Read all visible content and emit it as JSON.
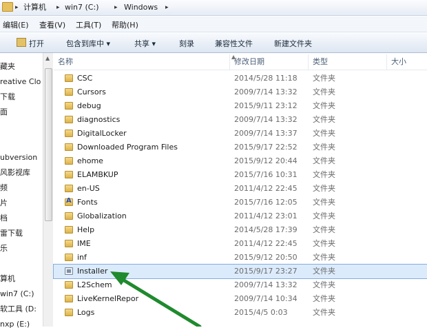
{
  "address": {
    "crumbs": [
      "计算机",
      "win7 (C:)",
      "Windows"
    ]
  },
  "menu": [
    "编辑(E)",
    "查看(V)",
    "工具(T)",
    "帮助(H)"
  ],
  "toolbar": {
    "open": "打开",
    "include": "包含到库中 ▾",
    "share": "共享 ▾",
    "burn": "刻录",
    "compat": "兼容性文件",
    "new_folder": "新建文件夹"
  },
  "nav": [
    "藏夹",
    "reative Clo",
    "下载",
    "面",
    "",
    "ubversion",
    "风影视库",
    "频",
    "片",
    "档",
    "雷下载",
    "乐",
    "",
    "算机",
    "win7 (C:)",
    "软工具 (D:",
    "nxp (E:)"
  ],
  "columns": {
    "name": "名称",
    "date": "修改日期",
    "type": "类型",
    "size": "大小"
  },
  "files": [
    {
      "name": "CSC",
      "date": "2014/5/28 11:18",
      "type": "文件夹",
      "icon": "folder-icon"
    },
    {
      "name": "Cursors",
      "date": "2009/7/14 13:32",
      "type": "文件夹",
      "icon": "folder-icon"
    },
    {
      "name": "debug",
      "date": "2015/9/11 23:12",
      "type": "文件夹",
      "icon": "folder-icon"
    },
    {
      "name": "diagnostics",
      "date": "2009/7/14 13:32",
      "type": "文件夹",
      "icon": "folder-icon"
    },
    {
      "name": "DigitalLocker",
      "date": "2009/7/14 13:37",
      "type": "文件夹",
      "icon": "folder-icon"
    },
    {
      "name": "Downloaded Program Files",
      "date": "2015/9/17 22:52",
      "type": "文件夹",
      "icon": "folder-icon"
    },
    {
      "name": "ehome",
      "date": "2015/9/12 20:44",
      "type": "文件夹",
      "icon": "folder-icon"
    },
    {
      "name": "ELAMBKUP",
      "date": "2015/7/16 10:31",
      "type": "文件夹",
      "icon": "folder-icon"
    },
    {
      "name": "en-US",
      "date": "2011/4/12 22:45",
      "type": "文件夹",
      "icon": "folder-icon"
    },
    {
      "name": "Fonts",
      "date": "2015/7/16 12:05",
      "type": "文件夹",
      "icon": "fonts-folder-icon"
    },
    {
      "name": "Globalization",
      "date": "2011/4/12 23:01",
      "type": "文件夹",
      "icon": "folder-icon"
    },
    {
      "name": "Help",
      "date": "2014/5/28 17:39",
      "type": "文件夹",
      "icon": "folder-icon"
    },
    {
      "name": "IME",
      "date": "2011/4/12 22:45",
      "type": "文件夹",
      "icon": "folder-icon"
    },
    {
      "name": "inf",
      "date": "2015/9/12 20:50",
      "type": "文件夹",
      "icon": "folder-icon"
    },
    {
      "name": "Installer",
      "date": "2015/9/17 23:27",
      "type": "文件夹",
      "icon": "installer-icon",
      "selected": true
    },
    {
      "name": "L2Schem",
      "date": "2009/7/14 13:32",
      "type": "文件夹",
      "icon": "folder-icon"
    },
    {
      "name": "LiveKernelRepor",
      "date": "2009/7/14 10:34",
      "type": "文件夹",
      "icon": "folder-icon"
    },
    {
      "name": "Logs",
      "date": "2015/4/5 0:03",
      "type": "文件夹",
      "icon": "folder-icon"
    }
  ],
  "colors": {
    "selection_bg": "#dcebfc",
    "selection_border": "#84acdd",
    "annotation_arrow": "#1f8a2e"
  }
}
